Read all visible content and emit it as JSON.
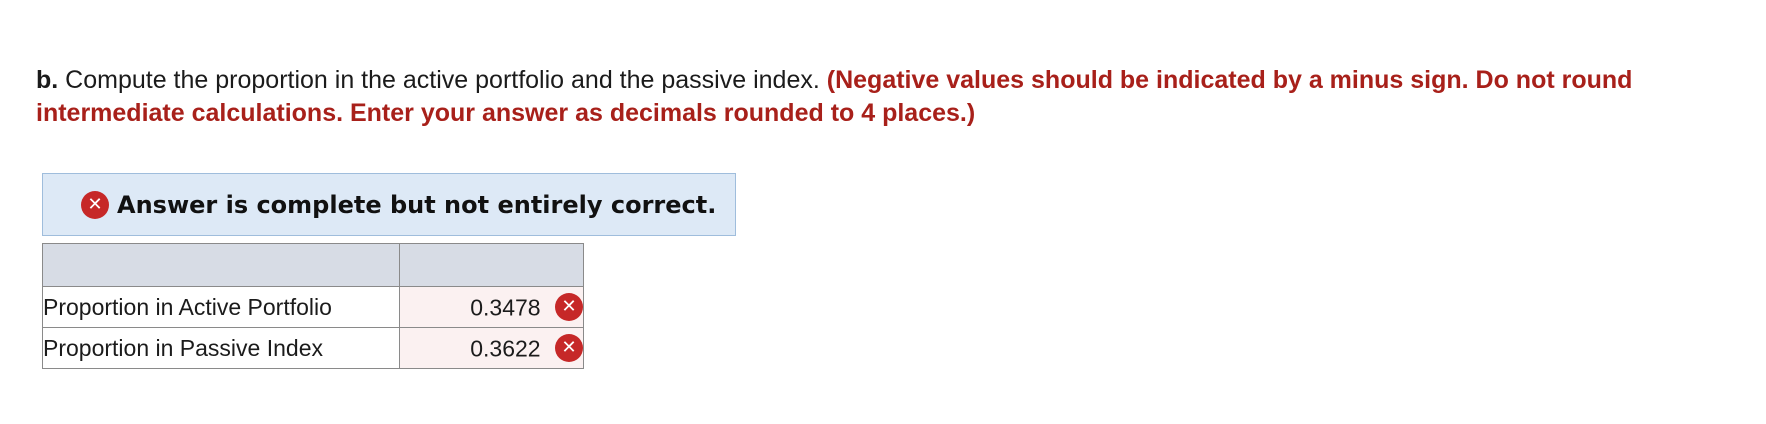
{
  "question": {
    "part_letter": "b.",
    "prompt": "Compute the proportion in the active portfolio and the passive index.",
    "instructions": "(Negative values should be indicated by a minus sign. Do not round intermediate calculations. Enter your answer as decimals rounded to 4 places.)"
  },
  "feedback": {
    "icon": "x-circle-icon",
    "message": "Answer is complete but not entirely correct.",
    "icon_color": "#c62828",
    "banner_color": "#dde9f6"
  },
  "table": {
    "headers": [
      "",
      ""
    ],
    "rows": [
      {
        "label": "Proportion in Active Portfolio",
        "value": "0.3478",
        "status": "incorrect"
      },
      {
        "label": "Proportion in Passive Index",
        "value": "0.3622",
        "status": "incorrect"
      }
    ],
    "incorrect_icon": "✕"
  }
}
